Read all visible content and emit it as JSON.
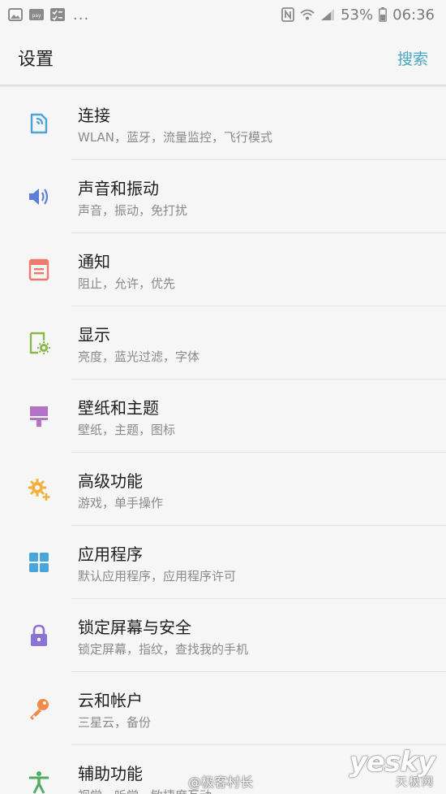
{
  "status_bar": {
    "left_icons": [
      "gallery-icon",
      "pay-icon",
      "checklist-icon"
    ],
    "pay_label": "pay",
    "more": "...",
    "battery": "53%",
    "time": "06:36"
  },
  "header": {
    "title": "设置",
    "search": "搜索"
  },
  "items": [
    {
      "title": "连接",
      "subtitle": "WLAN，蓝牙，流量监控，飞行模式",
      "icon": "connections-icon",
      "color": "#4aa6d8"
    },
    {
      "title": "声音和振动",
      "subtitle": "声音，振动，免打扰",
      "icon": "sound-icon",
      "color": "#5b7fd6"
    },
    {
      "title": "通知",
      "subtitle": "阻止，允许，优先",
      "icon": "notifications-icon",
      "color": "#ec7b6a"
    },
    {
      "title": "显示",
      "subtitle": "亮度，蓝光过滤，字体",
      "icon": "display-icon",
      "color": "#8bb84a"
    },
    {
      "title": "壁纸和主题",
      "subtitle": "壁纸，主题，图标",
      "icon": "wallpaper-icon",
      "color": "#b474c4"
    },
    {
      "title": "高级功能",
      "subtitle": "游戏，单手操作",
      "icon": "advanced-features-icon",
      "color": "#f1b23b"
    },
    {
      "title": "应用程序",
      "subtitle": "默认应用程序，应用程序许可",
      "icon": "apps-icon",
      "color": "#4aa6d8"
    },
    {
      "title": "锁定屏幕与安全",
      "subtitle": "锁定屏幕，指纹，查找我的手机",
      "icon": "lock-icon",
      "color": "#8b73d6"
    },
    {
      "title": "云和帐户",
      "subtitle": "三星云，备份",
      "icon": "key-icon",
      "color": "#f08a4a"
    },
    {
      "title": "辅助功能",
      "subtitle": "视觉，听觉，敏捷度互动",
      "icon": "accessibility-icon",
      "color": "#4fae5f"
    }
  ],
  "watermark": {
    "logo": "yesky",
    "sub": "天极网",
    "weibo": "@极客村长"
  }
}
